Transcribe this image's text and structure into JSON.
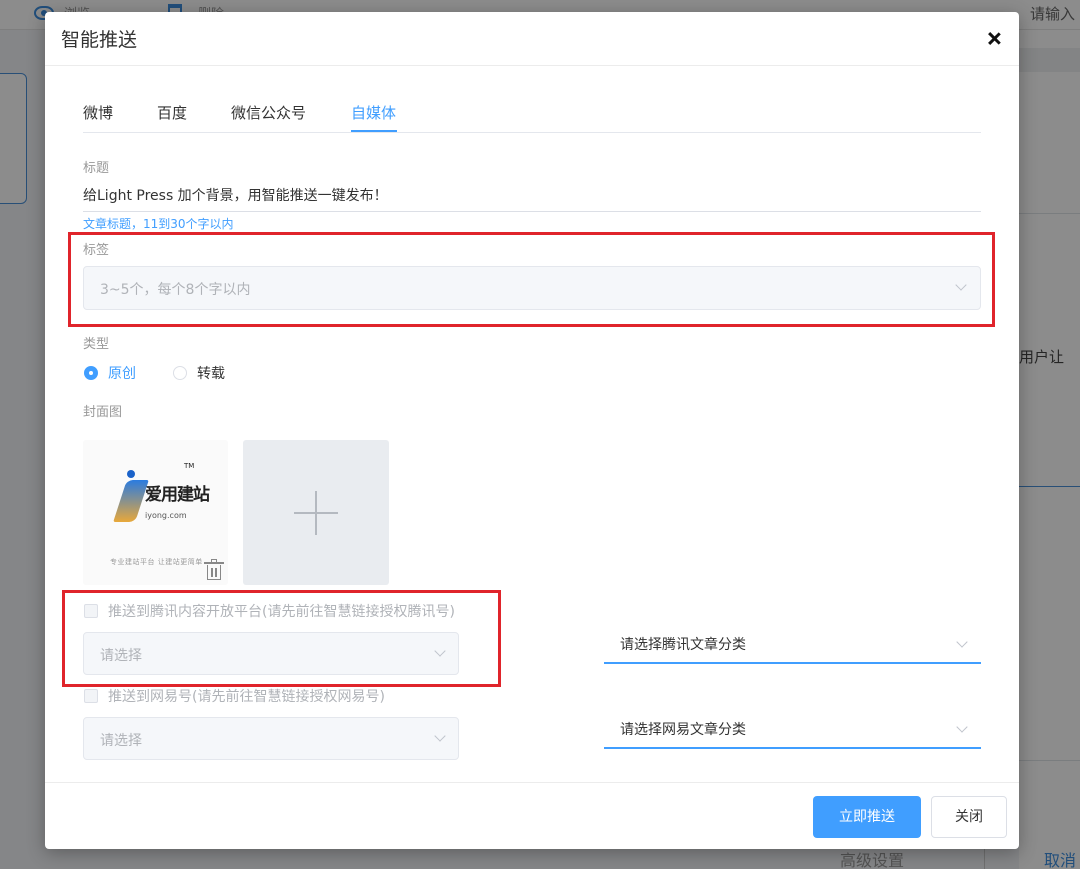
{
  "background": {
    "toolbar": {
      "preview_label": "浏览",
      "delete_label": "删除"
    },
    "right_column": {
      "search_placeholder": "请输入",
      "snippet_text": "用户让"
    },
    "bottom": {
      "advanced_label": "高级设置",
      "cancel_label": "取消"
    }
  },
  "dialog": {
    "title": "智能推送",
    "tabs": [
      {
        "label": "微博"
      },
      {
        "label": "百度"
      },
      {
        "label": "微信公众号"
      },
      {
        "label": "自媒体"
      }
    ],
    "active_tab": "自媒体",
    "title_field": {
      "label": "标题",
      "value": "给Light Press 加个背景，用智能推送一键发布！",
      "hint": "文章标题，11到30个字以内"
    },
    "tags_field": {
      "label": "标签",
      "placeholder": "3~5个，每个8个字以内"
    },
    "type_field": {
      "label": "类型",
      "options": [
        {
          "label": "原创",
          "checked": true
        },
        {
          "label": "转载",
          "checked": false
        }
      ]
    },
    "cover_field": {
      "label": "封面图",
      "logo": {
        "brand_cn": "爱用建站",
        "trademark": "TM",
        "url": "iyong.com",
        "slogan": "专业建站平台 让建站更简单"
      }
    },
    "tencent": {
      "checkbox_label": "推送到腾讯内容开放平台(请先前往智慧链接授权腾讯号)",
      "account_placeholder": "请选择",
      "category_placeholder": "请选择腾讯文章分类"
    },
    "netease": {
      "checkbox_label": "推送到网易号(请先前往智慧链接授权网易号)",
      "account_placeholder": "请选择",
      "category_placeholder": "请选择网易文章分类"
    },
    "footer": {
      "push_label": "立即推送",
      "close_label": "关闭"
    }
  },
  "colors": {
    "accent": "#409eff",
    "highlight_box": "#e0242b",
    "overlay": "rgba(0,0,0,0.45)"
  }
}
